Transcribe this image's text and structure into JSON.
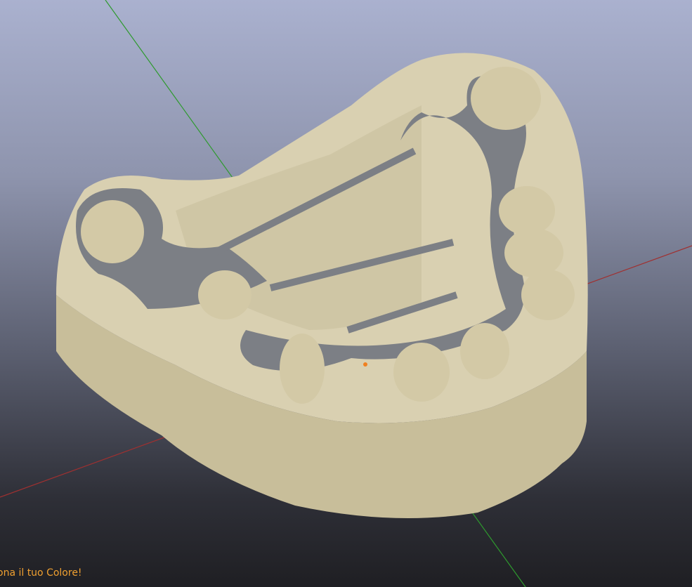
{
  "viewport": {
    "model": "dental-model-with-partial-denture-framework",
    "colors": {
      "model": "#d9d0b1",
      "model_side": "#c6bc98",
      "framework": "#7c7f85",
      "axis_x": "#b03030",
      "axis_y": "#2e9a2e"
    }
  },
  "status": {
    "message": "ona il tuo Colore!",
    "color": "#f0a030"
  }
}
